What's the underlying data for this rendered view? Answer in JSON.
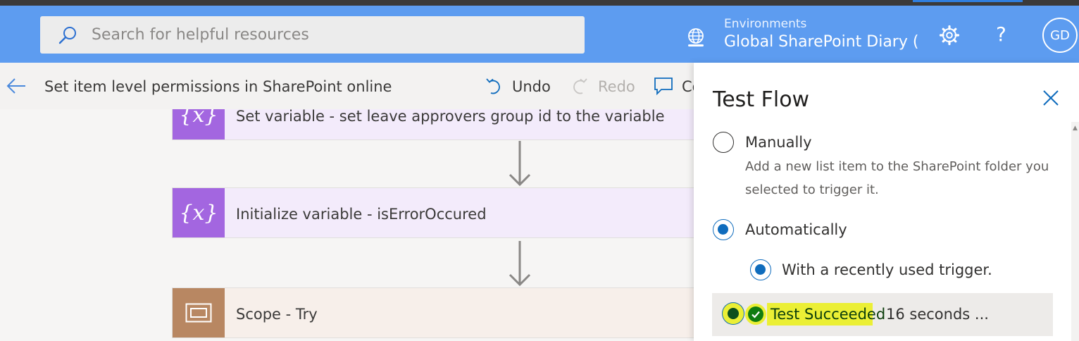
{
  "header": {
    "search": {
      "placeholder": "Search for helpful resources"
    },
    "environments": {
      "label": "Environments",
      "value": "Global SharePoint Diary ("
    },
    "help_label": "?",
    "avatar_initials": "GD",
    "colors": {
      "bar": "#5d9cf0",
      "accent": "#2f7fe0"
    }
  },
  "command_bar": {
    "flow_name": "Set item level permissions in SharePoint online",
    "undo_label": "Undo",
    "redo_label": "Redo",
    "comments_label": "Co"
  },
  "canvas": {
    "steps": [
      {
        "icon": "variable-icon",
        "glyph": "{x}",
        "label": "Set variable - set leave approvers group id to the variable",
        "color": "#a366e0"
      },
      {
        "icon": "variable-icon",
        "glyph": "{x}",
        "label": "Initialize variable - isErrorOccured",
        "color": "#a366e0"
      },
      {
        "icon": "scope-icon",
        "glyph": "",
        "label": "Scope - Try",
        "color": "#b88762"
      }
    ]
  },
  "test_panel": {
    "title": "Test Flow",
    "options": {
      "manually": {
        "label": "Manually",
        "description": "Add a new list item to the SharePoint folder you selected to trigger it.",
        "selected": false
      },
      "automatically": {
        "label": "Automatically",
        "selected": true
      },
      "recent_trigger": {
        "label": "With a recently used trigger.",
        "selected": true
      }
    },
    "runs": [
      {
        "status": "Test Succeeded",
        "time": "16 seconds ...",
        "selected": true,
        "highlight_color": "#ebef35"
      }
    ]
  }
}
